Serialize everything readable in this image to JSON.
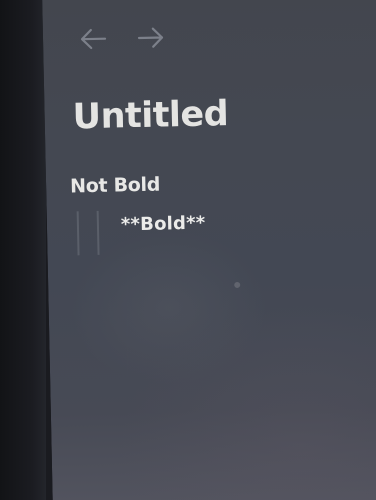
{
  "nav": {
    "back_icon": "arrow-left-icon",
    "forward_icon": "arrow-right-icon"
  },
  "page": {
    "title": "Untitled"
  },
  "blocks": [
    {
      "text": "Not Bold"
    },
    {
      "text": "**Bold**"
    }
  ],
  "colors": {
    "editor_background": "#444852",
    "text": "#e6e6e4",
    "nav_icon": "#7c808a",
    "indent_guide": "#70747c"
  }
}
